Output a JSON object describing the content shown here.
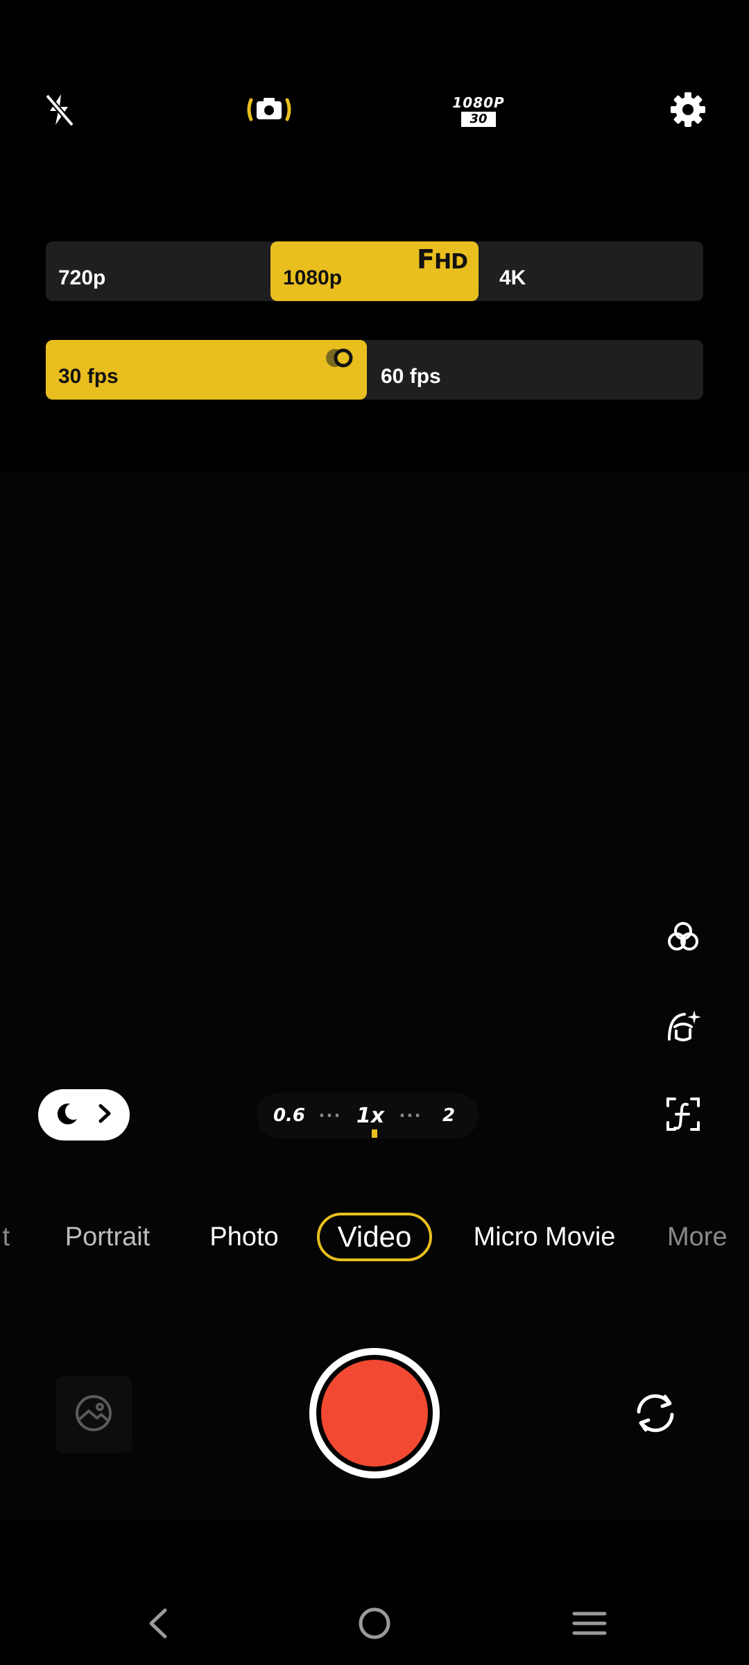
{
  "top_bar": {
    "flash_icon": "flash-off-icon",
    "stabilizer_icon": "camera-stabilization-icon",
    "resolution_badge": {
      "line1": "1080P",
      "line2": "30"
    },
    "settings_icon": "gear-icon"
  },
  "resolution_selector": {
    "options": [
      "720p",
      "1080p",
      "4K"
    ],
    "selected": "1080p",
    "tag": {
      "main": "F",
      "small": "HD"
    }
  },
  "fps_selector": {
    "options": [
      "30 fps",
      "60 fps"
    ],
    "selected": "30 fps"
  },
  "side_tools": [
    "filter-icon",
    "beauty-icon",
    "frame-icon"
  ],
  "zoom": {
    "levels": [
      "0.6",
      "1x",
      "2"
    ],
    "dots": "···",
    "selected": "1x"
  },
  "modes": [
    "t",
    "Portrait",
    "Photo",
    "Video",
    "Micro Movie",
    "More"
  ],
  "active_mode": "Video",
  "colors": {
    "accent": "#e9bf1f",
    "record": "#f24a32",
    "bar_bg": "#1f1f1f"
  }
}
